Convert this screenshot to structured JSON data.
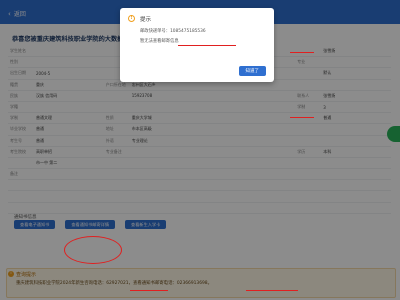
{
  "header": {
    "back_label": "返回"
  },
  "page": {
    "title": "恭喜您被重庆建筑科技职业学院的大数据技术"
  },
  "grid": [
    [
      "学生姓名",
      "",
      "",
      "",
      "",
      "",
      "",
      "张雪扬"
    ],
    [
      "性别",
      "",
      "",
      "",
      "",
      "",
      "专业",
      ""
    ],
    [
      "出生日期",
      "2004-5",
      "",
      "",
      "",
      "",
      "",
      "默认"
    ],
    [
      "籍贯",
      "重庆",
      "户口所在地",
      "忠州区大石乡",
      "",
      "",
      "",
      ""
    ],
    [
      "民族",
      "汉族 信用码",
      "",
      "15923708",
      "",
      "",
      "联系人",
      "张雪扬"
    ],
    [
      "学籍",
      "",
      "",
      "",
      "",
      "",
      "学制",
      "3"
    ],
    [
      "学制",
      "普通文理",
      "性质",
      "重庆大学城",
      "",
      "",
      "",
      "普通"
    ],
    [
      "毕业学校",
      "普通",
      "地址",
      "市本区高级",
      "",
      "",
      "",
      ""
    ],
    [
      "考生号",
      "普通",
      "外语",
      "专业理论",
      "",
      "",
      "",
      ""
    ],
    [
      "考生院校",
      "高职单招",
      "专业备注",
      "",
      "",
      "",
      "学历",
      "本科"
    ],
    [
      "",
      "市一中 第二",
      "",
      "",
      "",
      "",
      "",
      ""
    ],
    [
      "备注",
      "",
      "",
      "",
      "",
      "",
      "",
      ""
    ],
    [
      "",
      "",
      "",
      "",
      "",
      "",
      "",
      ""
    ],
    [
      "",
      "",
      "",
      "",
      "",
      "",
      "",
      ""
    ],
    [
      "",
      "",
      "",
      "",
      "",
      "",
      "",
      ""
    ]
  ],
  "notice": {
    "title": "通知书信息",
    "buttons": [
      "查看电子通知书",
      "查看通知书邮寄详情",
      "查看新生入学卡"
    ]
  },
  "query": {
    "title": "查询提示",
    "line": "重庆建筑科技职业学院2024年新生咨询电话：62927021，查看通知书邮寄电话：02366913698。"
  },
  "dialog": {
    "icon": "!",
    "title": "提示",
    "line1": "邮政快递单号：1085475185536",
    "line2": "暂无法查看邮寄信息",
    "ok_label": "知道了"
  }
}
